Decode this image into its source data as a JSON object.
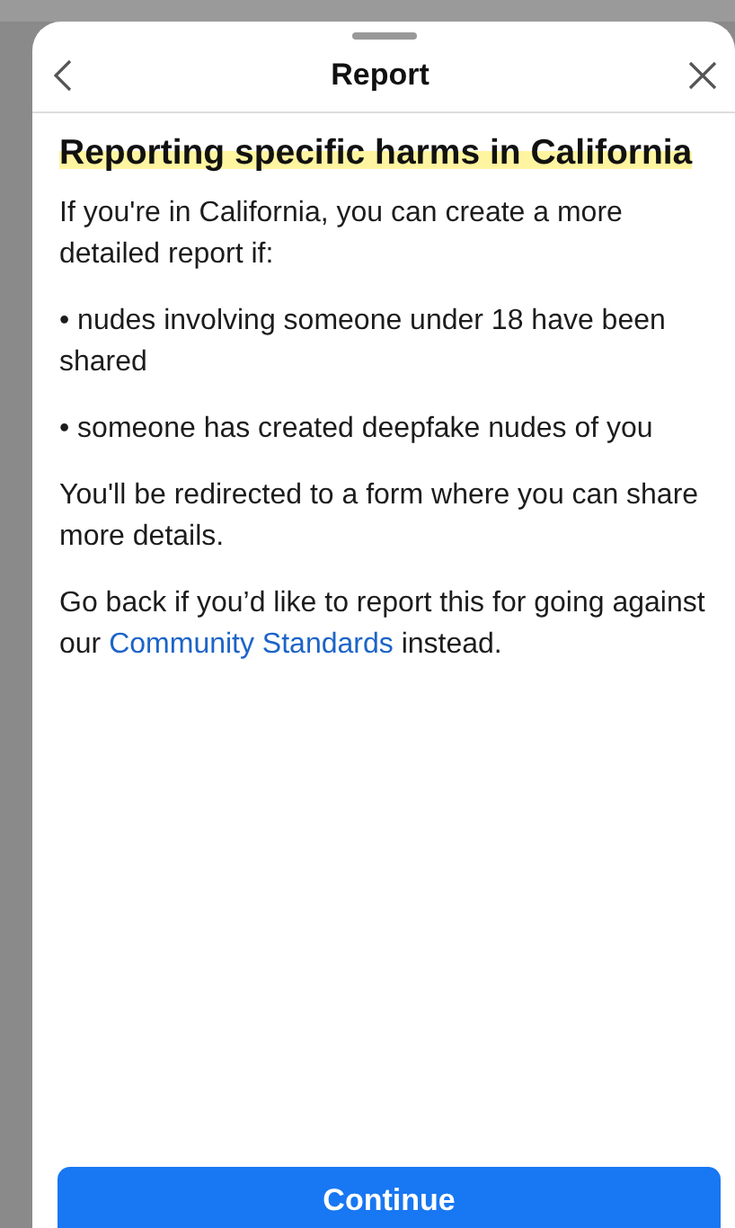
{
  "sheet": {
    "title": "Report"
  },
  "heading": "Reporting specific harms in California",
  "paragraphs": [
    {
      "kind": "text",
      "text": "If you're in California, you can create a more detailed report if:"
    },
    {
      "kind": "text",
      "text": "• nudes involving someone under 18 have been shared"
    },
    {
      "kind": "text",
      "text": "• someone has created deepfake nudes of you"
    },
    {
      "kind": "text",
      "text": "You'll be redirected to a form where you can share more details."
    },
    {
      "kind": "link",
      "before": "Go back if you’d like to report this for going against our ",
      "link": "Community Standards",
      "after": " instead."
    }
  ],
  "buttons": [
    "Continue"
  ]
}
